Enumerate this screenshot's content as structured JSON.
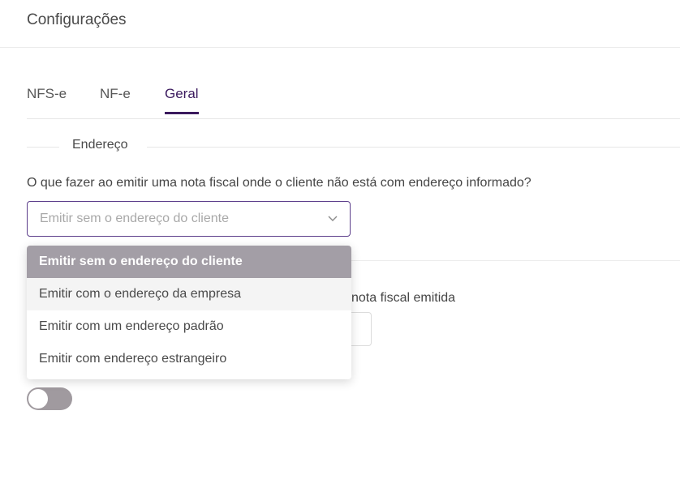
{
  "header": {
    "title": "Configurações"
  },
  "tabs": [
    {
      "label": "NFS-e",
      "active": false
    },
    {
      "label": "NF-e",
      "active": false
    },
    {
      "label": "Geral",
      "active": true
    }
  ],
  "section": {
    "legend": "Endereço"
  },
  "address_question": {
    "label": "O que fazer ao emitir uma nota fiscal onde o cliente não está com endereço informado?",
    "selected_value": "Emitir sem o endereço do cliente",
    "chevron_icon": "chevron-down-icon"
  },
  "dropdown": {
    "options": [
      {
        "label": "Emitir sem o endereço do cliente",
        "state": "selected"
      },
      {
        "label": "Emitir com o endereço da empresa",
        "state": "hover"
      },
      {
        "label": "Emitir com um endereço padrão",
        "state": "normal"
      },
      {
        "label": "Emitir com endereço estrangeiro",
        "state": "normal"
      }
    ]
  },
  "second_question": {
    "label_visible_part": "nota fiscal emitida"
  },
  "toggle": {
    "on": false
  },
  "colors": {
    "accent": "#3b1a5e",
    "select_border": "#5b3d8a",
    "selected_option_bg": "#a39ea6",
    "toggle_off": "#a09a9f"
  }
}
